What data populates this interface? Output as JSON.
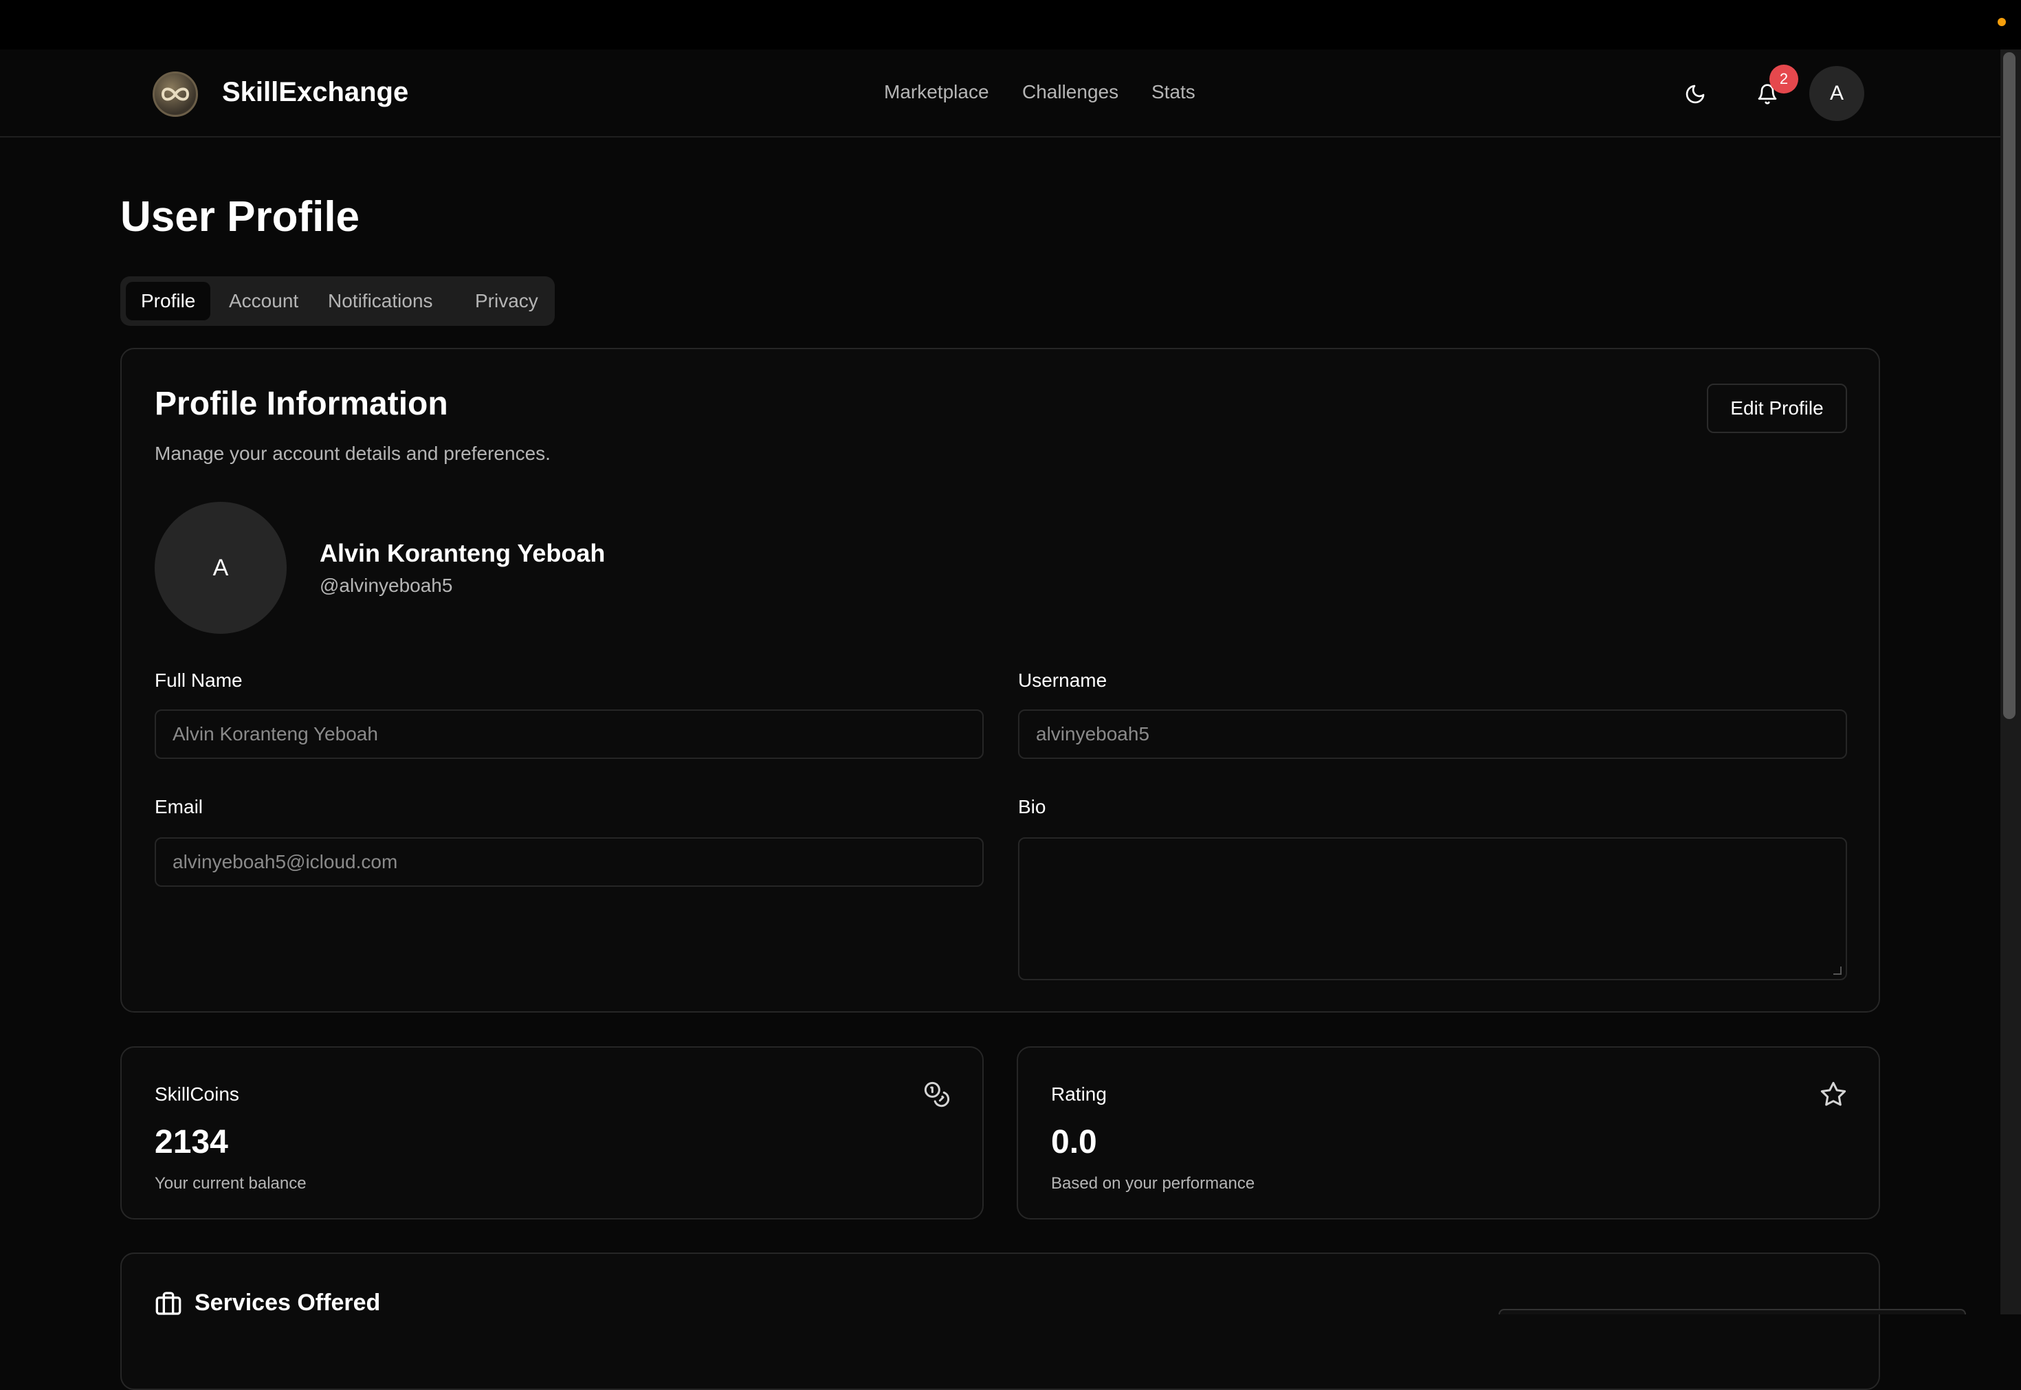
{
  "header": {
    "brand": "SkillExchange",
    "nav": [
      "Marketplace",
      "Challenges",
      "Stats"
    ],
    "notification_count": "2",
    "avatar_initial": "A"
  },
  "page": {
    "title": "User Profile",
    "tabs": [
      "Profile",
      "Account",
      "Notifications",
      "Privacy"
    ],
    "active_tab": "Profile"
  },
  "profile_card": {
    "title": "Profile Information",
    "subtitle": "Manage your account details and preferences.",
    "edit_button": "Edit Profile",
    "avatar_initial": "A",
    "display_name": "Alvin Koranteng Yeboah",
    "handle": "@alvinyeboah5"
  },
  "form": {
    "full_name_label": "Full Name",
    "full_name_value": "Alvin Koranteng Yeboah",
    "username_label": "Username",
    "username_value": "alvinyeboah5",
    "email_label": "Email",
    "email_value": "alvinyeboah5@icloud.com",
    "bio_label": "Bio",
    "bio_value": ""
  },
  "stats": {
    "skillcoins_label": "SkillCoins",
    "skillcoins_value": "2134",
    "skillcoins_sub": "Your current balance",
    "rating_label": "Rating",
    "rating_value": "0.0",
    "rating_sub": "Based on your performance"
  },
  "services": {
    "title": "Services Offered"
  },
  "icons": {
    "logo": "infinity-logo-icon",
    "theme": "moon-icon",
    "notifications": "bell-icon",
    "skillcoins": "coins-icon",
    "rating": "star-icon",
    "services": "briefcase-icon"
  },
  "colors": {
    "background": "#080808",
    "badge": "#e5484d",
    "status_dot": "#f59e0b"
  }
}
